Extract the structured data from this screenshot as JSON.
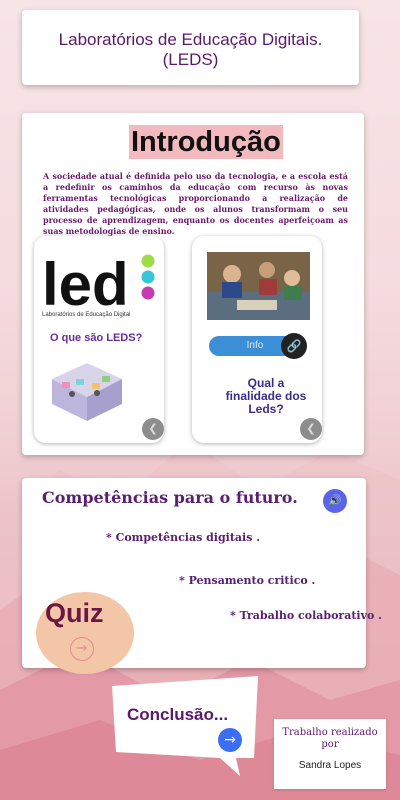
{
  "title": "Laboratórios de Educação Digitais.\n(LEDS)",
  "intro": {
    "heading": "Introdução",
    "text": "A sociedade atual é definida pelo uso da tecnologia, e a escola está a redefinir os caminhos da educação com recurso às novas ferramentas tecnológicas proporcionando a realização de atividades pedagógicas, onde os alunos transformam o seu processo de aprendizagem, enquanto os docentes aperfeiçoam as suas metodologias de ensino.",
    "led_caption": "Laboratórios de Educação Digital",
    "what_label": "O que são LEDS?",
    "info_label": "Info",
    "finalidade": "Qual a\nfinalidade dos\nLeds?"
  },
  "competencias": {
    "title": "Competências para o futuro.",
    "items": [
      "* Competências digitais .",
      "* Pensamento critico .",
      "* Trabalho colaborativo ."
    ]
  },
  "quiz": {
    "label": "Quiz"
  },
  "conclusion": {
    "label": "Conclusão..."
  },
  "credit": {
    "line": "Trabalho realizado\npor",
    "name": "Sandra Lopes"
  },
  "colors": {
    "title_purple": "#5a1a6a",
    "heading_bg": "#f2b9bf",
    "quiz_bg": "#f3c6a8",
    "accent_blue": "#3b6ef0"
  },
  "icons": [
    "speaker-icon",
    "link-icon",
    "arrow-right-icon",
    "chevron-icon"
  ]
}
